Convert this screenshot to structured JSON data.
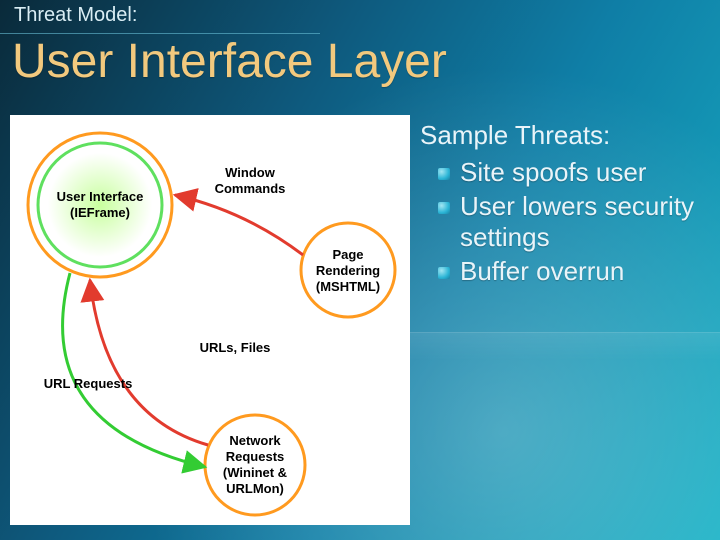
{
  "pretitle": "Threat Model:",
  "title": "User Interface Layer",
  "threats_heading": "Sample Threats:",
  "threats": {
    "item1": "Site spoofs user",
    "item2": "User lowers security settings",
    "item3": "Buffer overrun"
  },
  "diagram": {
    "nodes": {
      "ui1": "User Interface",
      "ui2": "(IEFrame)",
      "page1": "Page",
      "page2": "Rendering",
      "page3": "(MSHTML)",
      "net1": "Network",
      "net2": "Requests",
      "net3": "(Wininet &",
      "net4": "URLMon)"
    },
    "edges": {
      "wc1": "Window",
      "wc2": "Commands",
      "urls_files": "URLs, Files",
      "url_requests": "URL Requests"
    }
  },
  "colors": {
    "title_gold": "#f2c97e",
    "node_ui_outer": "#ff9a1f",
    "node_ui_inner": "#5fe05f",
    "node_page": "#ff9a1f",
    "node_net": "#ff9a1f",
    "arrow_red": "#e23b2e",
    "arrow_green": "#33cc33"
  }
}
